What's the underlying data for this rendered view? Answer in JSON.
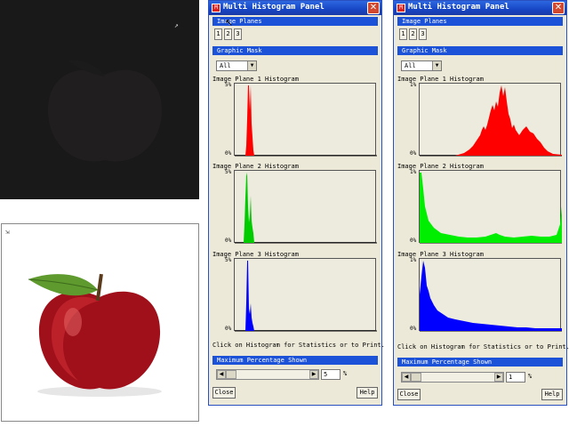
{
  "windows": [
    {
      "title": "Multi Histogram Panel",
      "image_planes_label": "Image Planes",
      "plane_buttons": [
        "1",
        "2",
        "3"
      ],
      "graphic_mask_label": "Graphic Mask",
      "mask_value": "All",
      "histograms": [
        {
          "label": "Image Plane 1 Histogram",
          "top_label": "5%",
          "bottom_label": "0%",
          "color": "#ff0000"
        },
        {
          "label": "Image Plane 2 Histogram",
          "top_label": "5%",
          "bottom_label": "0%",
          "color": "#00cc00"
        },
        {
          "label": "Image Plane 3 Histogram",
          "top_label": "5%",
          "bottom_label": "0%",
          "color": "#0000ff"
        }
      ],
      "footer_text": "Click on Histogram for Statistics or to Print.",
      "max_pct_label": "Maximum Percentage Shown",
      "max_pct_value": "5",
      "pct_sign": "%",
      "close_label": "Close",
      "help_label": "Help"
    },
    {
      "title": "Multi Histogram Panel",
      "image_planes_label": "Image Planes",
      "plane_buttons": [
        "1",
        "2",
        "3"
      ],
      "graphic_mask_label": "Graphic Mask",
      "mask_value": "All",
      "histograms": [
        {
          "label": "Image Plane 1 Histogram",
          "top_label": "1%",
          "bottom_label": "0%",
          "color": "#ff0000"
        },
        {
          "label": "Image Plane 2 Histogram",
          "top_label": "1%",
          "bottom_label": "0%",
          "color": "#00ee00"
        },
        {
          "label": "Image Plane 3 Histogram",
          "top_label": "1%",
          "bottom_label": "0%",
          "color": "#0000ff"
        }
      ],
      "footer_text": "Click on Histogram for Statistics or to Print.",
      "max_pct_label": "Maximum Percentage Shown",
      "max_pct_value": "1",
      "pct_sign": "%",
      "close_label": "Close",
      "help_label": "Help"
    }
  ],
  "icons": {
    "title_icon": "app-icon",
    "close": "close-icon",
    "scroll_left": "arrow-left-icon",
    "scroll_right": "arrow-right-icon",
    "dropdown": "chevron-down-icon"
  },
  "colors": {
    "title_bar": "#1746c4",
    "section_bar": "#1c52d8",
    "window_bg": "#ece9d8"
  }
}
